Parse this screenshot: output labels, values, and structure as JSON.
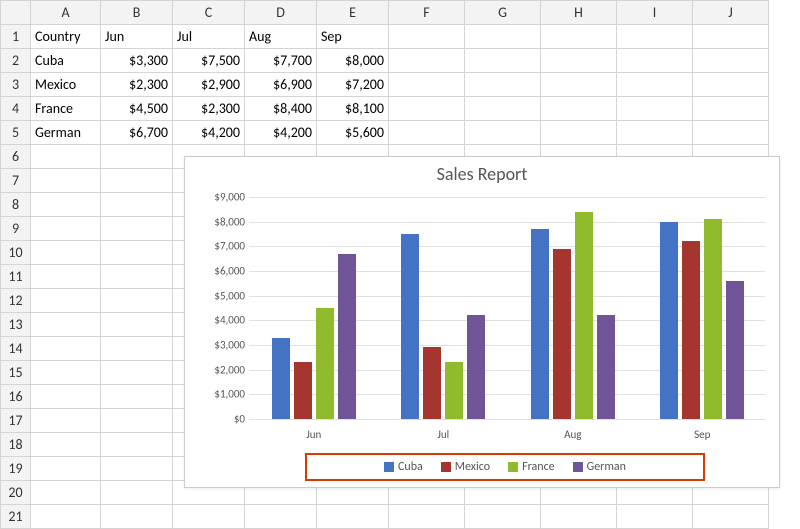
{
  "grid": {
    "col_headers": [
      "A",
      "B",
      "C",
      "D",
      "E",
      "F",
      "G",
      "H",
      "I",
      "J"
    ],
    "rows": 21,
    "data": {
      "header_row": [
        "Country",
        "Jun",
        "Jul",
        "Aug",
        "Sep"
      ],
      "body": [
        [
          "Cuba",
          "$3,300",
          "$7,500",
          "$7,700",
          "$8,000"
        ],
        [
          "Mexico",
          "$2,300",
          "$2,900",
          "$6,900",
          "$7,200"
        ],
        [
          "France",
          "$4,500",
          "$2,300",
          "$8,400",
          "$8,100"
        ],
        [
          "German",
          "$6,700",
          "$4,200",
          "$4,200",
          "$5,600"
        ]
      ]
    }
  },
  "chart_data": {
    "type": "bar",
    "title": "Sales Report",
    "categories": [
      "Jun",
      "Jul",
      "Aug",
      "Sep"
    ],
    "series": [
      {
        "name": "Cuba",
        "color": "#4472c4",
        "values": [
          3300,
          7500,
          7700,
          8000
        ]
      },
      {
        "name": "Mexico",
        "color": "#a5352f",
        "values": [
          2300,
          2900,
          6900,
          7200
        ]
      },
      {
        "name": "France",
        "color": "#8fbb2c",
        "values": [
          4500,
          2300,
          8400,
          8100
        ]
      },
      {
        "name": "German",
        "color": "#6f5498",
        "values": [
          6700,
          4200,
          4200,
          5600
        ]
      }
    ],
    "ylim": [
      0,
      9000
    ],
    "yticks_fmt": [
      "$0",
      "$1,000",
      "$2,000",
      "$3,000",
      "$4,000",
      "$5,000",
      "$6,000",
      "$7,000",
      "$8,000",
      "$9,000"
    ],
    "ytick_values": [
      0,
      1000,
      2000,
      3000,
      4000,
      5000,
      6000,
      7000,
      8000,
      9000
    ],
    "xlabel": "",
    "ylabel": ""
  }
}
